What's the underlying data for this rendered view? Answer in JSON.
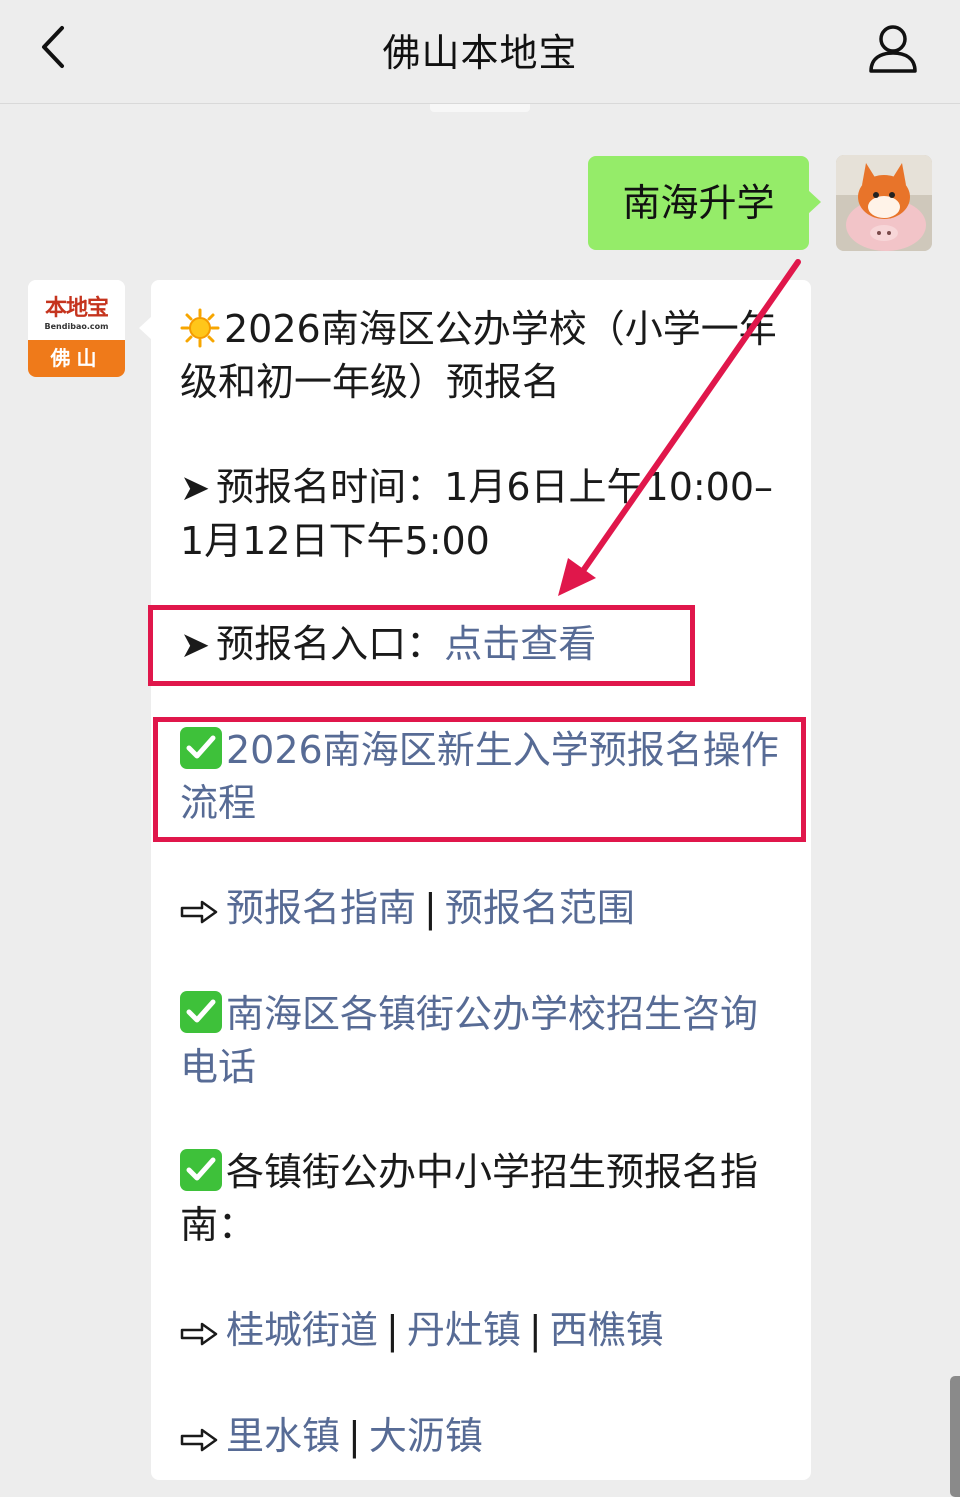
{
  "header": {
    "title": "佛山本地宝"
  },
  "outgoing": {
    "text": "南海升学"
  },
  "bot": {
    "logo_text": "本地宝",
    "logo_url": "Bendibao.com",
    "logo_city": "佛山"
  },
  "message": {
    "headline": "2026南海区公办学校（小学一年级和初一年级）预报名",
    "time_label": "预报名时间：1月6日上午10:00–1月12日下午5:00",
    "entry_label": "预报名入口：",
    "entry_link": "点击查看",
    "process_link": "2026南海区新生入学预报名操作流程",
    "guide_link": "预报名指南",
    "range_link": "预报名范围",
    "separator": "|",
    "phone_link": "南海区各镇街公办学校招生咨询电话",
    "towns_heading": "各镇街公办中小学招生预报名指南：",
    "towns_row1": [
      "桂城街道",
      "丹灶镇",
      "西樵镇"
    ],
    "towns_row2": [
      "里水镇",
      "大沥镇"
    ]
  },
  "colors": {
    "link": "#576b95",
    "highlight": "#e0174b",
    "outgoing_bubble": "#95ec69",
    "check_green": "#3ec13a"
  },
  "icons": [
    "back-chevron-icon",
    "profile-icon",
    "sun-emoji-icon",
    "check-mark-emoji-icon",
    "black-arrow-icon",
    "white-arrow-icon"
  ]
}
